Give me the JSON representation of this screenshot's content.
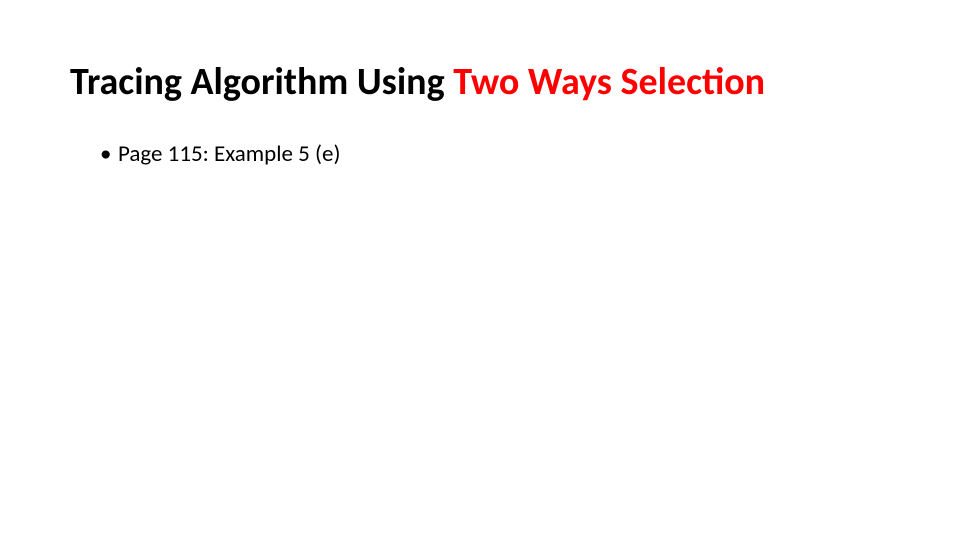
{
  "slide": {
    "title_part1": "Tracing Algorithm Using ",
    "title_part2": "Two Ways Selection",
    "bullet1": "Page 115: Example 5 (e)"
  }
}
